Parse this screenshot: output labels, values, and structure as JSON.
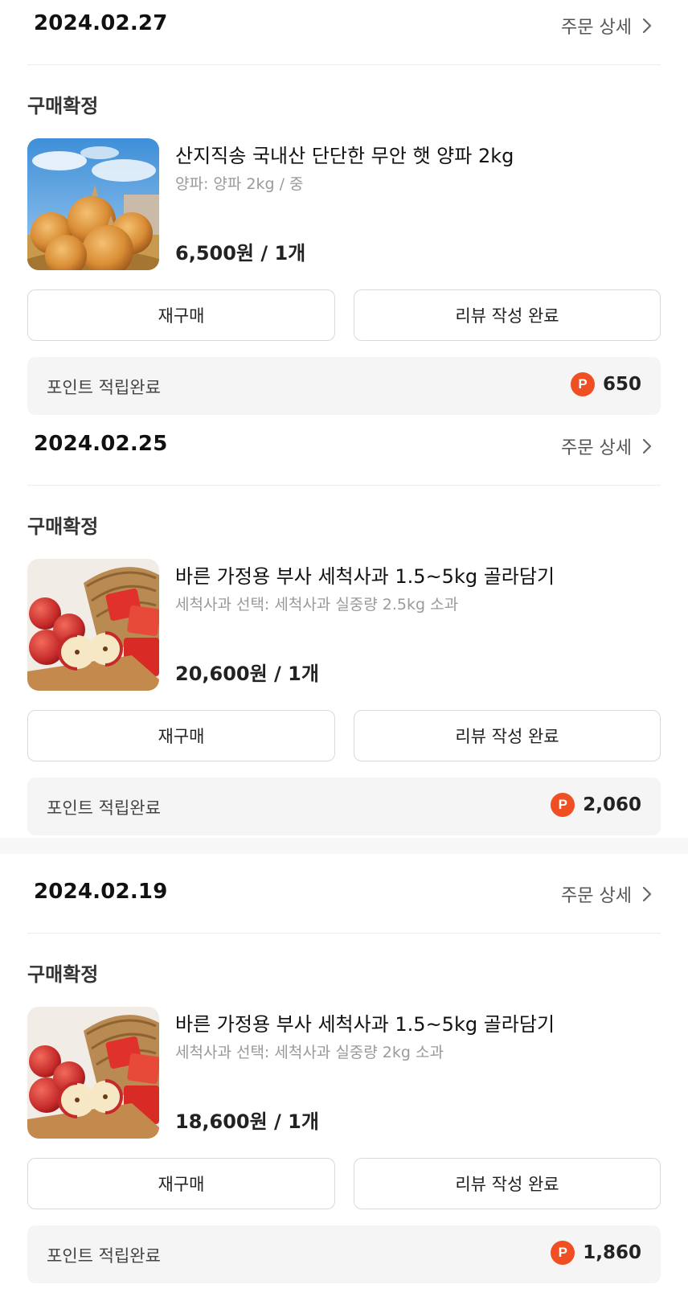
{
  "orders": [
    {
      "date": "2024.02.27",
      "detail_label": "주문 상세",
      "status": "구매확정",
      "product": {
        "title": "산지직송 국내산 단단한 무안 햇 양파 2kg",
        "option": "양파: 양파 2kg / 중",
        "price": "6,500원 / 1개",
        "image": "onion-photo"
      },
      "rebuy_label": "재구매",
      "review_label": "리뷰 작성 완료",
      "points_label": "포인트 적립완료",
      "points_value": "650"
    },
    {
      "date": "2024.02.25",
      "detail_label": "주문 상세",
      "status": "구매확정",
      "product": {
        "title": "바른 가정용 부사 세척사과 1.5~5kg 골라담기",
        "option": "세척사과 선택: 세척사과 실중량 2.5kg 소과",
        "price": "20,600원 / 1개",
        "image": "apple-photo"
      },
      "rebuy_label": "재구매",
      "review_label": "리뷰 작성 완료",
      "points_label": "포인트 적립완료",
      "points_value": "2,060"
    },
    {
      "date": "2024.02.19",
      "detail_label": "주문 상세",
      "status": "구매확정",
      "product": {
        "title": "바른 가정용 부사 세척사과 1.5~5kg 골라담기",
        "option": "세척사과 선택: 세척사과 실중량 2kg 소과",
        "price": "18,600원 / 1개",
        "image": "apple-photo"
      },
      "rebuy_label": "재구매",
      "review_label": "리뷰 작성 완료",
      "points_label": "포인트 적립완료",
      "points_value": "1,860"
    }
  ],
  "points_icon_letter": "P",
  "colors": {
    "points_badge": "#f04e23",
    "points_bg": "#f5f5f5"
  }
}
